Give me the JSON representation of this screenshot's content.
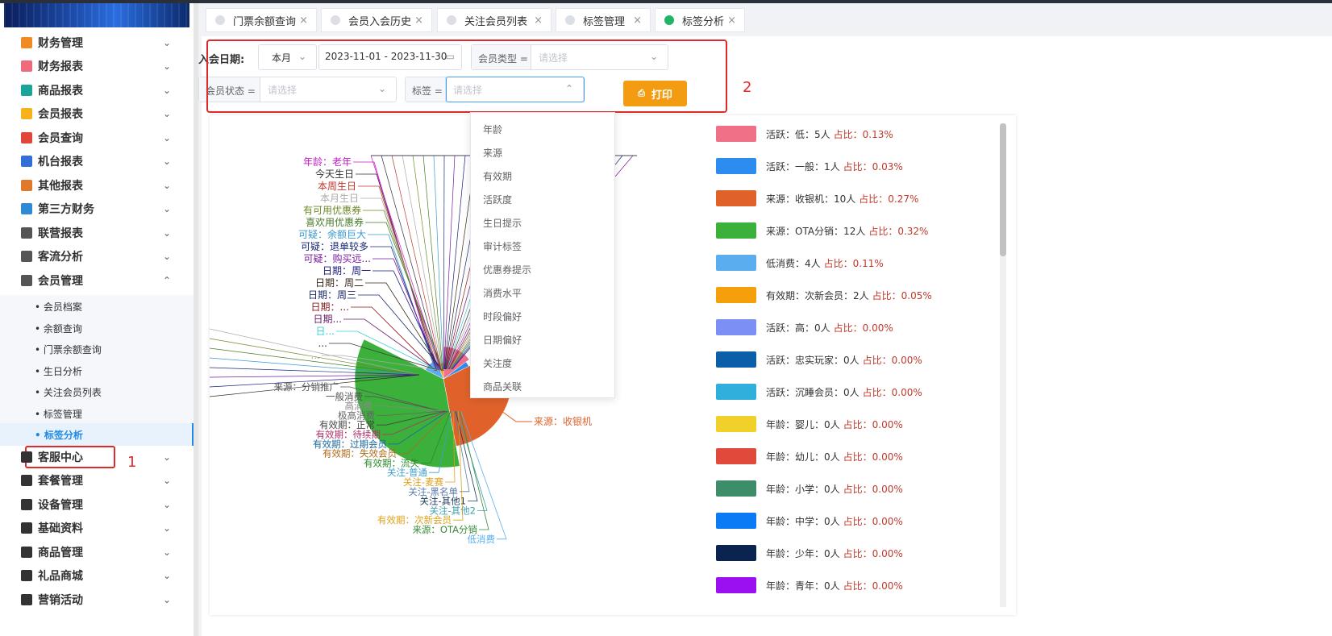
{
  "sidebar": {
    "menu": [
      {
        "label": "财务管理",
        "icon": "finance-icon",
        "color": "#f08a24",
        "chev": "⌄"
      },
      {
        "label": "财务报表",
        "icon": "finance-report-icon",
        "color": "#f06a7d",
        "chev": "⌄"
      },
      {
        "label": "商品报表",
        "icon": "goods-report-icon",
        "color": "#1aa59a",
        "chev": "⌄"
      },
      {
        "label": "会员报表",
        "icon": "member-report-icon",
        "color": "#f5b21a",
        "chev": "⌄"
      },
      {
        "label": "会员查询",
        "icon": "member-query-icon",
        "color": "#e0463a",
        "chev": "⌄"
      },
      {
        "label": "机台报表",
        "icon": "machine-report-icon",
        "color": "#2f6fd6",
        "chev": "⌄"
      },
      {
        "label": "其他报表",
        "icon": "layers-icon",
        "color": "#e07a2a",
        "chev": "⌄"
      },
      {
        "label": "第三方财务",
        "icon": "calculator-icon",
        "color": "#2f8ad6",
        "chev": "⌄"
      },
      {
        "label": "联营报表",
        "icon": "users-icon",
        "color": "#555555",
        "chev": "⌄"
      },
      {
        "label": "客流分析",
        "icon": "target-icon",
        "color": "#555555",
        "chev": "⌄"
      },
      {
        "label": "会员管理",
        "icon": "user-circle-icon",
        "color": "#555555",
        "chev": "⌃"
      }
    ],
    "submenu": [
      {
        "label": "会员档案"
      },
      {
        "label": "余额查询"
      },
      {
        "label": "门票余额查询"
      },
      {
        "label": "生日分析"
      },
      {
        "label": "关注会员列表"
      },
      {
        "label": "标签管理"
      },
      {
        "label": "标签分析",
        "active": true
      }
    ],
    "menu2": [
      {
        "label": "客服中心",
        "icon": "headset-icon",
        "color": "#333333",
        "chev": "⌄"
      },
      {
        "label": "套餐管理",
        "icon": "package-icon",
        "color": "#333333",
        "chev": "⌄"
      },
      {
        "label": "设备管理",
        "icon": "wrench-icon",
        "color": "#333333",
        "chev": "⌄"
      },
      {
        "label": "基础资料",
        "icon": "file-icon",
        "color": "#333333",
        "chev": "⌄"
      },
      {
        "label": "商品管理",
        "icon": "swap-icon",
        "color": "#333333",
        "chev": "⌄"
      },
      {
        "label": "礼品商城",
        "icon": "tag-icon",
        "color": "#333333",
        "chev": "⌄"
      },
      {
        "label": "营销活动",
        "icon": "tag2-icon",
        "color": "#333333",
        "chev": "⌄"
      }
    ],
    "annotation": "1"
  },
  "tabs": [
    {
      "label": "门票余额查询",
      "close": "×"
    },
    {
      "label": "会员入会历史",
      "close": "×"
    },
    {
      "label": "关注会员列表",
      "close": "×"
    },
    {
      "label": "标签管理",
      "close": "×"
    },
    {
      "label": "标签分析",
      "close": "×",
      "active": true
    }
  ],
  "filters": {
    "join_date_label": "入会日期:",
    "period_value": "本月",
    "date_range": "2023-11-01 - 2023-11-30",
    "member_type_label": "会员类型 =",
    "member_type_placeholder": "请选择",
    "member_status_label": "会员状态 =",
    "member_status_placeholder": "请选择",
    "tag_label": "标签 =",
    "tag_placeholder": "请选择",
    "print_label": "打印",
    "annotation": "2"
  },
  "tag_dropdown": [
    "年龄",
    "来源",
    "有效期",
    "活跃度",
    "生日提示",
    "审计标签",
    "优惠券提示",
    "消费水平",
    "时段偏好",
    "日期偏好",
    "关注度",
    "商品关联"
  ],
  "chart_data": {
    "type": "pie",
    "legend_position": "right",
    "slices": [
      {
        "label": "活跃：低：5人",
        "pct": "占比：0.13%",
        "value": 5,
        "color": "#f07088"
      },
      {
        "label": "活跃：一般：1人",
        "pct": "占比：0.03%",
        "value": 1,
        "color": "#2d8cf0"
      },
      {
        "label": "来源：收银机：10人",
        "pct": "占比：0.27%",
        "value": 10,
        "color": "#e0622a"
      },
      {
        "label": "来源：OTA分销：12人",
        "pct": "占比：0.32%",
        "value": 12,
        "color": "#3bb03b"
      },
      {
        "label": "低消费：4人",
        "pct": "占比：0.11%",
        "value": 4,
        "color": "#5aaef0"
      },
      {
        "label": "有效期：次新会员：2人",
        "pct": "占比：0.05%",
        "value": 2,
        "color": "#f5a00a"
      },
      {
        "label": "活跃：高：0人",
        "pct": "占比：0.00%",
        "value": 0,
        "color": "#7b8ff5"
      },
      {
        "label": "活跃：忠实玩家：0人",
        "pct": "占比：0.00%",
        "value": 0,
        "color": "#0b5ea8"
      },
      {
        "label": "活跃：沉睡会员：0人",
        "pct": "占比：0.00%",
        "value": 0,
        "color": "#2fb0dc"
      },
      {
        "label": "年龄：婴儿：0人",
        "pct": "占比：0.00%",
        "value": 0,
        "color": "#f2d02a"
      },
      {
        "label": "年龄：幼儿：0人",
        "pct": "占比：0.00%",
        "value": 0,
        "color": "#e04a3a"
      },
      {
        "label": "年龄：小学：0人",
        "pct": "占比：0.00%",
        "value": 0,
        "color": "#3d8c6a"
      },
      {
        "label": "年龄：中学：0人",
        "pct": "占比：0.00%",
        "value": 0,
        "color": "#0a7af5"
      },
      {
        "label": "年龄：少年：0人",
        "pct": "占比：0.00%",
        "value": 0,
        "color": "#0b234f"
      },
      {
        "label": "年龄：青年：0人",
        "pct": "占比：0.00%",
        "value": 0,
        "color": "#9b10f0"
      }
    ],
    "slice_labels": {
      "left": [
        {
          "text": "年龄：老年",
          "color": "#c41ec4"
        },
        {
          "text": "今天生日",
          "color": "#333333"
        },
        {
          "text": "本周生日",
          "color": "#c0392b"
        },
        {
          "text": "本月生日",
          "color": "#aaaaaa"
        },
        {
          "text": "有可用优惠券",
          "color": "#6a8a2a"
        },
        {
          "text": "喜欢用优惠券",
          "color": "#4a7a2a"
        },
        {
          "text": "可疑：余额巨大",
          "color": "#3a9ad0"
        },
        {
          "text": "可疑：退单较多",
          "color": "#1a2a7a"
        },
        {
          "text": "可疑：购买远...",
          "color": "#7a1aa0"
        },
        {
          "text": "日期：周一",
          "color": "#1a1a7a"
        },
        {
          "text": "日期：周二",
          "color": "#3a2a1a"
        },
        {
          "text": "日期：周三",
          "color": "#1a2a6a"
        },
        {
          "text": "日期：...",
          "color": "#8a1a1a"
        },
        {
          "text": "日期...",
          "color": "#6a1a6a"
        },
        {
          "text": "日...",
          "color": "#3ad0d0"
        },
        {
          "text": "...",
          "color": "#3a3a3a"
        },
        {
          "text": "...",
          "color": "#aaaaaa"
        }
      ],
      "bottom": [
        {
          "text": "来源：分销推广",
          "color": "#555555"
        },
        {
          "text": "一般消费",
          "color": "#555555"
        },
        {
          "text": "高消费",
          "color": "#888888"
        },
        {
          "text": "极高消费",
          "color": "#666666"
        },
        {
          "text": "有效期：正常",
          "color": "#444444"
        },
        {
          "text": "有效期：待续期",
          "color": "#b0306a"
        },
        {
          "text": "有效期：过期会员",
          "color": "#1a6aa0"
        },
        {
          "text": "有效期：失效会员",
          "color": "#b06a1a"
        },
        {
          "text": "有效期：流失",
          "color": "#2a8a2a"
        },
        {
          "text": "关注-普通",
          "color": "#3aa0d0"
        },
        {
          "text": "关注-麦赛",
          "color": "#e0a01a"
        },
        {
          "text": "关注-黑名单",
          "color": "#5a7ab0"
        },
        {
          "text": "关注-其他1",
          "color": "#1a3a5a"
        },
        {
          "text": "关注-其他2",
          "color": "#3aa0b0"
        },
        {
          "text": "有效期：次新会员",
          "color": "#e0a01a"
        },
        {
          "text": "来源：OTA分销",
          "color": "#3a8a3a"
        },
        {
          "text": "低消费",
          "color": "#5aaef0"
        }
      ],
      "right": [
        {
          "text": "来源：收银机",
          "color": "#e0622a"
        }
      ]
    }
  }
}
